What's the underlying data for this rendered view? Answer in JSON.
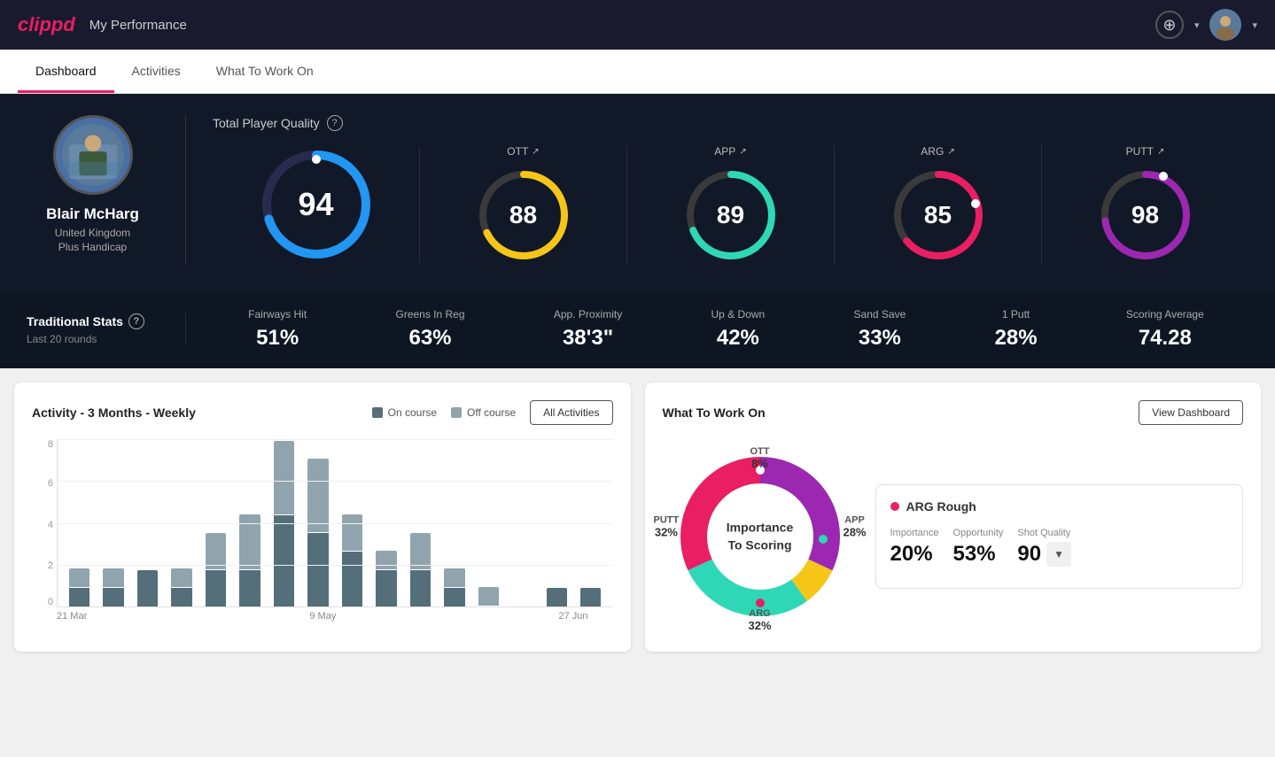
{
  "header": {
    "logo": "clippd",
    "title": "My Performance",
    "add_label": "+",
    "dropdown_label": "▾"
  },
  "nav": {
    "tabs": [
      {
        "label": "Dashboard",
        "active": true
      },
      {
        "label": "Activities",
        "active": false
      },
      {
        "label": "What To Work On",
        "active": false
      }
    ]
  },
  "hero": {
    "player": {
      "name": "Blair McHarg",
      "country": "United Kingdom",
      "handicap": "Plus Handicap"
    },
    "total_quality_label": "Total Player Quality",
    "scores": [
      {
        "label": "OTT",
        "value": 88,
        "color": "#f5c518",
        "track": "#3a3a3a"
      },
      {
        "label": "APP",
        "value": 89,
        "color": "#2ed8b6",
        "track": "#3a3a3a"
      },
      {
        "label": "ARG",
        "value": 85,
        "color": "#e91e63",
        "track": "#3a3a3a"
      },
      {
        "label": "PUTT",
        "value": 98,
        "color": "#9c27b0",
        "track": "#3a3a3a"
      }
    ],
    "main_score": {
      "value": 94,
      "color": "#2196f3"
    },
    "stats_label": "Traditional Stats",
    "stats_sub": "Last 20 rounds",
    "stats": [
      {
        "name": "Fairways Hit",
        "value": "51%"
      },
      {
        "name": "Greens In Reg",
        "value": "63%"
      },
      {
        "name": "App. Proximity",
        "value": "38'3\""
      },
      {
        "name": "Up & Down",
        "value": "42%"
      },
      {
        "name": "Sand Save",
        "value": "33%"
      },
      {
        "name": "1 Putt",
        "value": "28%"
      },
      {
        "name": "Scoring Average",
        "value": "74.28"
      }
    ]
  },
  "activity_chart": {
    "title": "Activity - 3 Months - Weekly",
    "legend": [
      {
        "label": "On course",
        "color": "#546e7a"
      },
      {
        "label": "Off course",
        "color": "#90a4ae"
      }
    ],
    "all_activities_label": "All Activities",
    "x_labels": [
      "21 Mar",
      "9 May",
      "27 Jun"
    ],
    "y_labels": [
      "8",
      "6",
      "4",
      "2",
      "0"
    ],
    "bars": [
      {
        "on": 1,
        "off": 1
      },
      {
        "on": 1,
        "off": 1
      },
      {
        "on": 2,
        "off": 0
      },
      {
        "on": 1,
        "off": 1
      },
      {
        "on": 2,
        "off": 2
      },
      {
        "on": 2,
        "off": 3
      },
      {
        "on": 5,
        "off": 4
      },
      {
        "on": 4,
        "off": 4
      },
      {
        "on": 3,
        "off": 2
      },
      {
        "on": 2,
        "off": 1
      },
      {
        "on": 2,
        "off": 2
      },
      {
        "on": 1,
        "off": 1
      },
      {
        "on": 0,
        "off": 1
      },
      {
        "on": 0,
        "off": 0
      },
      {
        "on": 1,
        "off": 0
      },
      {
        "on": 1,
        "off": 0
      }
    ]
  },
  "work_on": {
    "title": "What To Work On",
    "view_dashboard_label": "View Dashboard",
    "donut_center": "Importance\nTo Scoring",
    "segments": [
      {
        "label": "OTT",
        "value": "8%",
        "color": "#f5c518"
      },
      {
        "label": "APP",
        "value": "28%",
        "color": "#2ed8b6"
      },
      {
        "label": "ARG",
        "value": "32%",
        "color": "#e91e63"
      },
      {
        "label": "PUTT",
        "value": "32%",
        "color": "#9c27b0"
      }
    ],
    "detail": {
      "title": "ARG Rough",
      "dot_color": "#e91e63",
      "metrics": [
        {
          "label": "Importance",
          "value": "20%"
        },
        {
          "label": "Opportunity",
          "value": "53%"
        },
        {
          "label": "Shot Quality",
          "value": "90",
          "badge": "▼"
        }
      ]
    }
  }
}
